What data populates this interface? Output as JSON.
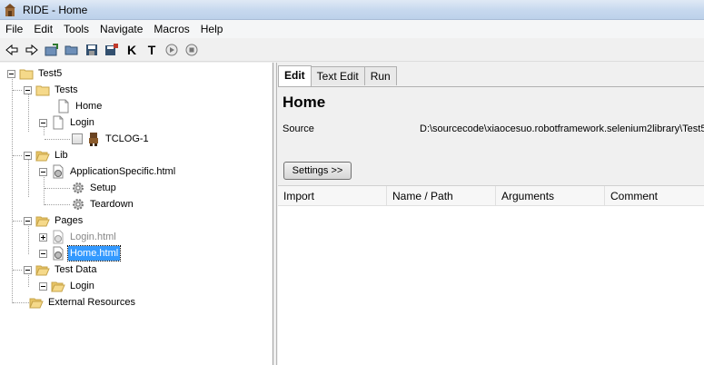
{
  "window": {
    "title": "RIDE - Home"
  },
  "menu": {
    "items": [
      "File",
      "Edit",
      "Tools",
      "Navigate",
      "Macros",
      "Help"
    ]
  },
  "toolbar": {
    "buttons": [
      "back-arrow-icon",
      "forward-arrow-icon",
      "open-suite-icon",
      "open-directory-icon",
      "save-icon",
      "save-all-icon",
      "search-keywords-icon",
      "search-tests-icon",
      "run-icon",
      "stop-icon"
    ],
    "keyword_glyph": "K",
    "test_glyph": "T"
  },
  "tree": {
    "root": "Test5",
    "tests": "Tests",
    "home": "Home",
    "login": "Login",
    "tc": "TCLOG-1",
    "lib": "Lib",
    "appspecific": "ApplicationSpecific.html",
    "setup": "Setup",
    "teardown": "Teardown",
    "pages": "Pages",
    "login_html": "Login.html",
    "home_html": "Home.html",
    "testdata": "Test Data",
    "td_login": "Login",
    "external": "External Resources"
  },
  "tabs": [
    "Edit",
    "Text Edit",
    "Run"
  ],
  "editor": {
    "title": "Home",
    "source_label": "Source",
    "source_value": "D:\\sourcecode\\xiaocesuo.robotframework.selenium2library\\Test5",
    "settings_button": "Settings >>",
    "columns": [
      "Import",
      "Name / Path",
      "Arguments",
      "Comment"
    ]
  },
  "colors": {
    "selection": "#3399ff",
    "folder": "#f5d98a",
    "titlebar": "#c6d8ee"
  }
}
